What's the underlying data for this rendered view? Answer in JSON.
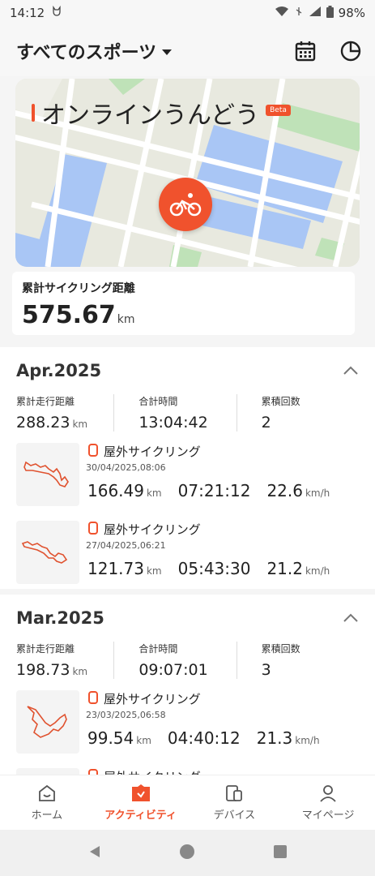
{
  "status": {
    "time": "14:12",
    "battery": "98%"
  },
  "header": {
    "title": "すべてのスポーツ"
  },
  "map": {
    "title": "オンラインうんどう",
    "beta": "Beta"
  },
  "total": {
    "label": "累計サイクリング距離",
    "value": "575.67",
    "unit": "km"
  },
  "months": [
    {
      "title": "Apr.2025",
      "stats": [
        {
          "label": "累計走行距離",
          "value": "288.23",
          "unit": "km"
        },
        {
          "label": "合計時間",
          "value": "13:04:42",
          "unit": ""
        },
        {
          "label": "累積回数",
          "value": "2",
          "unit": ""
        }
      ],
      "activities": [
        {
          "title": "屋外サイクリング",
          "date": "30/04/2025,08:06",
          "distance": "166.49",
          "distance_unit": "km",
          "duration": "07:21:12",
          "speed": "22.6",
          "speed_unit": "km/h"
        },
        {
          "title": "屋外サイクリング",
          "date": "27/04/2025,06:21",
          "distance": "121.73",
          "distance_unit": "km",
          "duration": "05:43:30",
          "speed": "21.2",
          "speed_unit": "km/h"
        }
      ]
    },
    {
      "title": "Mar.2025",
      "stats": [
        {
          "label": "累計走行距離",
          "value": "198.73",
          "unit": "km"
        },
        {
          "label": "合計時間",
          "value": "09:07:01",
          "unit": ""
        },
        {
          "label": "累積回数",
          "value": "3",
          "unit": ""
        }
      ],
      "activities": [
        {
          "title": "屋外サイクリング",
          "date": "23/03/2025,06:58",
          "distance": "99.54",
          "distance_unit": "km",
          "duration": "04:40:12",
          "speed": "21.3",
          "speed_unit": "km/h"
        },
        {
          "title": "屋外サイクリング",
          "date": "",
          "distance": "",
          "distance_unit": "",
          "duration": "",
          "speed": "",
          "speed_unit": ""
        }
      ]
    }
  ],
  "nav": {
    "home": "ホーム",
    "activity": "アクティビティ",
    "devices": "デバイス",
    "mypage": "マイページ"
  },
  "colors": {
    "accent": "#f0522d"
  }
}
